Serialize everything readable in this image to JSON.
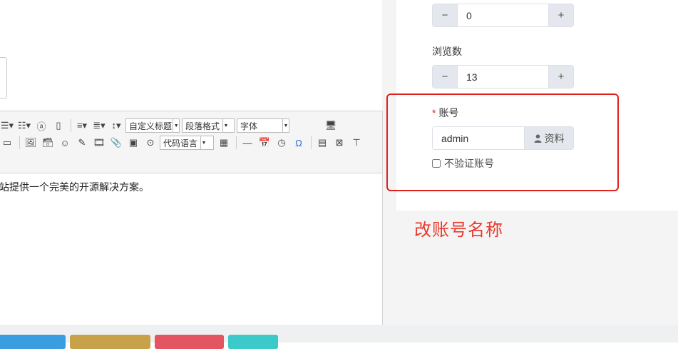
{
  "form": {
    "top_stepper": {
      "value": "0",
      "minus": "−",
      "plus": "+"
    },
    "views": {
      "label": "浏览数",
      "value": "13",
      "minus": "−",
      "plus": "+"
    },
    "account": {
      "required_mark": "*",
      "label": "账号",
      "value": "admin",
      "profile_button": "资料",
      "no_verify_label": "不验证账号"
    }
  },
  "annotation": {
    "text": "改账号名称",
    "color": "#e8392b"
  },
  "editor": {
    "content_text": "站提供一个完美的开源解决方案。",
    "toolbar_selects": {
      "custom_heading": "自定义标题",
      "paragraph_format": "段落格式",
      "font": "字体",
      "code_language": "代码语言"
    }
  },
  "bottom_buttons": {
    "colors": [
      "#3a9de0",
      "#c8a24a",
      "#e25561",
      "#3cc9c9"
    ]
  },
  "colors": {
    "highlight_border": "#e0201d",
    "panel_bg": "#f4f4f5"
  }
}
